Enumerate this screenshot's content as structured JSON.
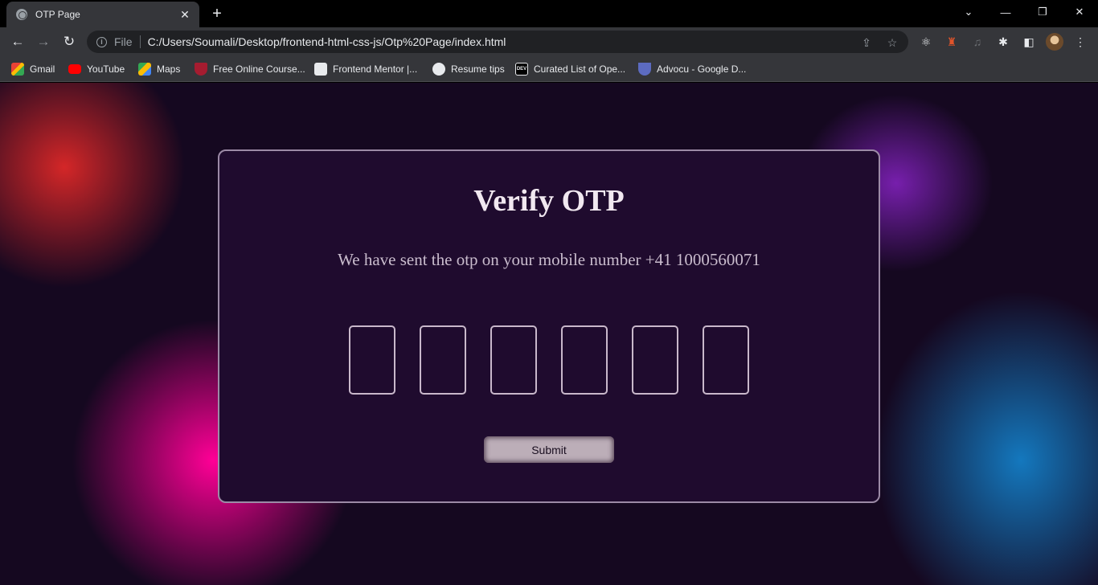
{
  "browser": {
    "tab_title": "OTP Page",
    "tab_close": "✕",
    "new_tab": "+",
    "window_controls": {
      "tab_search": "⌄",
      "minimize": "—",
      "restore": "❐",
      "close": "✕"
    },
    "nav": {
      "back": "←",
      "forward": "→",
      "reload": "↻"
    },
    "address": {
      "scheme_label": "File",
      "url": "C:/Users/Soumali/Desktop/frontend-html-css-js/Otp%20Page/index.html"
    },
    "bookmarks": [
      {
        "label": "Gmail",
        "icon": "gmail-icon",
        "color": "#ea4335"
      },
      {
        "label": "YouTube",
        "icon": "youtube-icon",
        "color": "#ff0000"
      },
      {
        "label": "Maps",
        "icon": "maps-icon",
        "color": "#34a853"
      },
      {
        "label": "Free Online Course...",
        "icon": "harvard-icon",
        "color": "#a51c30"
      },
      {
        "label": "Frontend Mentor |...",
        "icon": "frontend-mentor-icon",
        "color": "#e8eaed"
      },
      {
        "label": "Resume tips",
        "icon": "globe-icon",
        "color": "#e8eaed"
      },
      {
        "label": "Curated List of Ope...",
        "icon": "dev-icon",
        "color": "#000000"
      },
      {
        "label": "Advocu - Google D...",
        "icon": "advocu-icon",
        "color": "#5c6bc0"
      }
    ]
  },
  "otp": {
    "heading": "Verify OTP",
    "message": "We have sent the otp on your mobile number +41 1000560071",
    "digits": [
      "",
      "",
      "",
      "",
      "",
      ""
    ],
    "submit_label": "Submit"
  },
  "colors": {
    "card_border": "#9c8aa6",
    "card_bg": "#1f0b2e",
    "page_bg": "#150820",
    "button_bg": "#bcaeb8"
  }
}
